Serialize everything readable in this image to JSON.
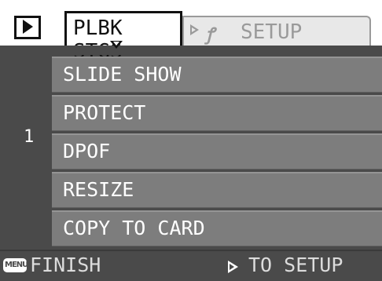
{
  "header": {
    "mode_icon": "playback-icon",
    "active_tab": "PLBK STGS",
    "inactive_tab": "SETUP",
    "inactive_tab_icon": "wrench-icon"
  },
  "page_number": "1",
  "menu": {
    "items": [
      {
        "label": "SLIDE SHOW"
      },
      {
        "label": "PROTECT"
      },
      {
        "label": "DPOF"
      },
      {
        "label": "RESIZE"
      },
      {
        "label": "COPY TO CARD"
      }
    ]
  },
  "footer": {
    "menu_key_icon": "MENU",
    "finish_label": "FINISH",
    "to_setup_label": "TO SETUP"
  }
}
